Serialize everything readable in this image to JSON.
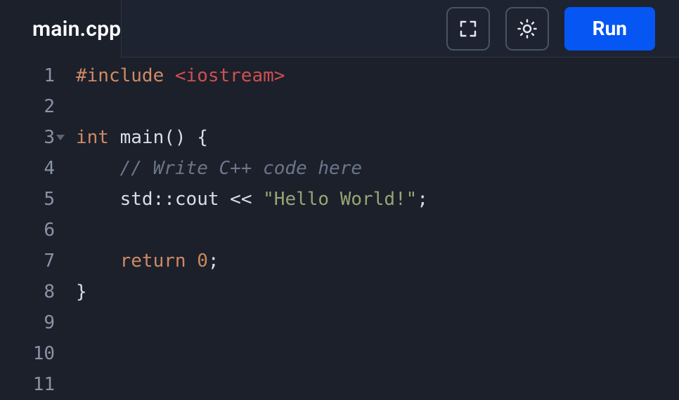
{
  "tab": {
    "title": "main.cpp"
  },
  "toolbar": {
    "fullscreen_name": "fullscreen-icon",
    "theme_name": "sun-icon",
    "run_label": "Run"
  },
  "editor": {
    "total_lines": 11,
    "fold_line": 3,
    "lines": [
      {
        "n": 1,
        "tokens": [
          {
            "cls": "tok-pp",
            "t": "#include"
          },
          {
            "cls": "",
            "t": " "
          },
          {
            "cls": "tok-inc",
            "t": "<iostream>"
          }
        ]
      },
      {
        "n": 2,
        "tokens": []
      },
      {
        "n": 3,
        "tokens": [
          {
            "cls": "tok-kw",
            "t": "int"
          },
          {
            "cls": "",
            "t": " "
          },
          {
            "cls": "tok-fn",
            "t": "main"
          },
          {
            "cls": "tok-punc",
            "t": "() {"
          }
        ]
      },
      {
        "n": 4,
        "tokens": [
          {
            "cls": "",
            "t": "    "
          },
          {
            "cls": "tok-cmnt",
            "t": "// Write C++ code here"
          }
        ]
      },
      {
        "n": 5,
        "tokens": [
          {
            "cls": "",
            "t": "    "
          },
          {
            "cls": "tok-fn",
            "t": "std"
          },
          {
            "cls": "tok-punc",
            "t": "::"
          },
          {
            "cls": "tok-fn",
            "t": "cout"
          },
          {
            "cls": "tok-op",
            "t": " << "
          },
          {
            "cls": "tok-str",
            "t": "\"Hello World!\""
          },
          {
            "cls": "tok-punc",
            "t": ";"
          }
        ]
      },
      {
        "n": 6,
        "tokens": []
      },
      {
        "n": 7,
        "tokens": [
          {
            "cls": "",
            "t": "    "
          },
          {
            "cls": "tok-kw",
            "t": "return"
          },
          {
            "cls": "",
            "t": " "
          },
          {
            "cls": "tok-num",
            "t": "0"
          },
          {
            "cls": "tok-punc",
            "t": ";"
          }
        ]
      },
      {
        "n": 8,
        "tokens": [
          {
            "cls": "tok-punc",
            "t": "}"
          }
        ]
      },
      {
        "n": 9,
        "tokens": []
      },
      {
        "n": 10,
        "tokens": []
      },
      {
        "n": 11,
        "tokens": []
      }
    ]
  }
}
